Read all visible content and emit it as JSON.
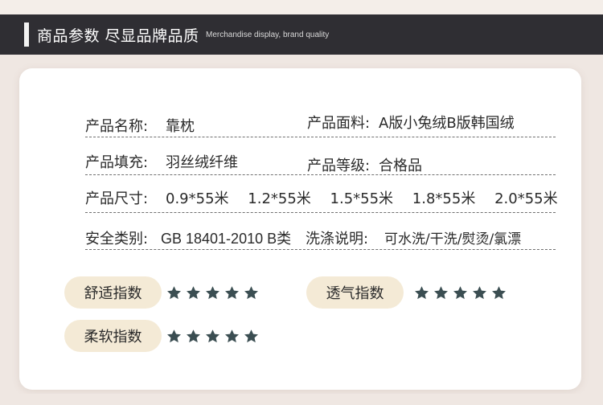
{
  "header": {
    "title": "商品参数 尽显品牌品质",
    "subtitle": "Merchandise display, brand quality"
  },
  "params": {
    "name_label": "产品名称:",
    "name_value": "靠枕",
    "fabric_label": "产品面料:",
    "fabric_value": "A版小兔绒B版韩国绒",
    "filling_label": "产品填充:",
    "filling_value": "羽丝绒纤维",
    "grade_label": "产品等级:",
    "grade_value": "合格品",
    "size_label": "产品尺寸:",
    "sizes": [
      "0.9*55米",
      "1.2*55米",
      "1.5*55米",
      "1.8*55米",
      "2.0*55米"
    ],
    "safety_label": "安全类别:",
    "safety_value": "GB 18401-2010  B类",
    "wash_label": "洗涤说明:",
    "wash_value": "可水洗/干洗/熨烫/氯漂"
  },
  "ratings": [
    {
      "label": "舒适指数",
      "stars": 5
    },
    {
      "label": "透气指数",
      "stars": 5
    },
    {
      "label": "柔软指数",
      "stars": 5
    }
  ],
  "colors": {
    "header_bg": "#2f2e33",
    "badge_bg": "#f4ead6",
    "star": "#3b4e52"
  },
  "icons": {
    "rating": "star-icon"
  }
}
